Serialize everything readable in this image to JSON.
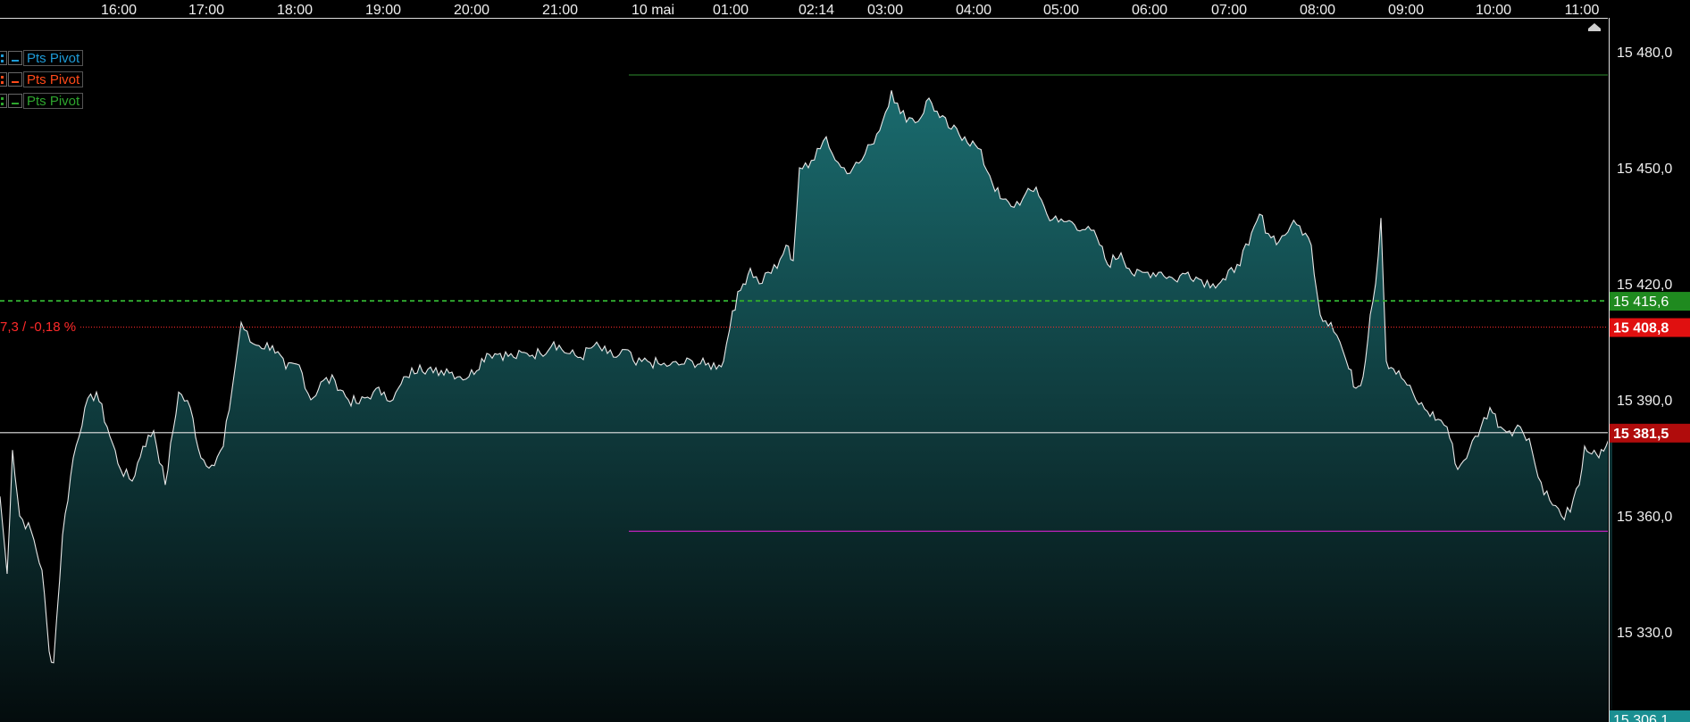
{
  "chart_data": {
    "type": "area",
    "time_labels": [
      "16:00",
      "17:00",
      "18:00",
      "19:00",
      "20:00",
      "21:00",
      "10 mai",
      "01:00",
      "02:14",
      "03:00",
      "04:00",
      "05:00",
      "06:00",
      "07:00",
      "08:00",
      "09:00",
      "10:00",
      "11:00"
    ],
    "y_ticks": [
      "15 480,0",
      "15 450,0",
      "15 420,0",
      "15 390,0",
      "15 360,0",
      "15 330,0"
    ],
    "y_tick_values": [
      15480,
      15450,
      15420,
      15390,
      15360,
      15330
    ],
    "ylim": [
      15296,
      15490
    ],
    "x_anchors": [
      {
        "t": 0,
        "v": 15365
      },
      {
        "t": 8,
        "v": 15345
      },
      {
        "t": 14,
        "v": 15377
      },
      {
        "t": 22,
        "v": 15360
      },
      {
        "t": 35,
        "v": 15356
      },
      {
        "t": 47,
        "v": 15346
      },
      {
        "t": 55,
        "v": 15325
      },
      {
        "t": 60,
        "v": 15322
      },
      {
        "t": 70,
        "v": 15355
      },
      {
        "t": 82,
        "v": 15375
      },
      {
        "t": 95,
        "v": 15388
      },
      {
        "t": 108,
        "v": 15392
      },
      {
        "t": 120,
        "v": 15383
      },
      {
        "t": 135,
        "v": 15372
      },
      {
        "t": 148,
        "v": 15369
      },
      {
        "t": 160,
        "v": 15378
      },
      {
        "t": 172,
        "v": 15382
      },
      {
        "t": 185,
        "v": 15368
      },
      {
        "t": 200,
        "v": 15392
      },
      {
        "t": 213,
        "v": 15388
      },
      {
        "t": 225,
        "v": 15375
      },
      {
        "t": 240,
        "v": 15373
      },
      {
        "t": 250,
        "v": 15378
      },
      {
        "t": 260,
        "v": 15393
      },
      {
        "t": 270,
        "v": 15410
      },
      {
        "t": 280,
        "v": 15405
      },
      {
        "t": 290,
        "v": 15404
      },
      {
        "t": 305,
        "v": 15404
      },
      {
        "t": 320,
        "v": 15398
      },
      {
        "t": 335,
        "v": 15399
      },
      {
        "t": 348,
        "v": 15390
      },
      {
        "t": 362,
        "v": 15395
      },
      {
        "t": 375,
        "v": 15395
      },
      {
        "t": 390,
        "v": 15390
      },
      {
        "t": 402,
        "v": 15389
      },
      {
        "t": 418,
        "v": 15392
      },
      {
        "t": 430,
        "v": 15392
      },
      {
        "t": 440,
        "v": 15390
      },
      {
        "t": 455,
        "v": 15396
      },
      {
        "t": 470,
        "v": 15399
      },
      {
        "t": 485,
        "v": 15397
      },
      {
        "t": 500,
        "v": 15398
      },
      {
        "t": 515,
        "v": 15396
      },
      {
        "t": 525,
        "v": 15396
      },
      {
        "t": 545,
        "v": 15402
      },
      {
        "t": 560,
        "v": 15402
      },
      {
        "t": 575,
        "v": 15401
      },
      {
        "t": 590,
        "v": 15402
      },
      {
        "t": 605,
        "v": 15402
      },
      {
        "t": 620,
        "v": 15405
      },
      {
        "t": 635,
        "v": 15402
      },
      {
        "t": 650,
        "v": 15401
      },
      {
        "t": 665,
        "v": 15404
      },
      {
        "t": 680,
        "v": 15402
      },
      {
        "t": 690,
        "v": 15401
      },
      {
        "t": 700,
        "v": 15403
      },
      {
        "t": 712,
        "v": 15399
      },
      {
        "t": 725,
        "v": 15400
      },
      {
        "t": 740,
        "v": 15399
      },
      {
        "t": 750,
        "v": 15399
      },
      {
        "t": 760,
        "v": 15399
      },
      {
        "t": 775,
        "v": 15400
      },
      {
        "t": 790,
        "v": 15399
      },
      {
        "t": 805,
        "v": 15399
      },
      {
        "t": 810,
        "v": 15400
      },
      {
        "t": 820,
        "v": 15413
      },
      {
        "t": 832,
        "v": 15420
      },
      {
        "t": 840,
        "v": 15424
      },
      {
        "t": 850,
        "v": 15420
      },
      {
        "t": 860,
        "v": 15423
      },
      {
        "t": 870,
        "v": 15424
      },
      {
        "t": 880,
        "v": 15430
      },
      {
        "t": 888,
        "v": 15426
      },
      {
        "t": 895,
        "v": 15450
      },
      {
        "t": 905,
        "v": 15450
      },
      {
        "t": 915,
        "v": 15455
      },
      {
        "t": 925,
        "v": 15458
      },
      {
        "t": 935,
        "v": 15452
      },
      {
        "t": 945,
        "v": 15450
      },
      {
        "t": 955,
        "v": 15450
      },
      {
        "t": 965,
        "v": 15452
      },
      {
        "t": 975,
        "v": 15456
      },
      {
        "t": 988,
        "v": 15462
      },
      {
        "t": 998,
        "v": 15470
      },
      {
        "t": 1008,
        "v": 15464
      },
      {
        "t": 1018,
        "v": 15463
      },
      {
        "t": 1028,
        "v": 15462
      },
      {
        "t": 1040,
        "v": 15468
      },
      {
        "t": 1052,
        "v": 15463
      },
      {
        "t": 1065,
        "v": 15460
      },
      {
        "t": 1080,
        "v": 15458
      },
      {
        "t": 1095,
        "v": 15455
      },
      {
        "t": 1108,
        "v": 15448
      },
      {
        "t": 1120,
        "v": 15442
      },
      {
        "t": 1132,
        "v": 15440
      },
      {
        "t": 1145,
        "v": 15442
      },
      {
        "t": 1160,
        "v": 15445
      },
      {
        "t": 1172,
        "v": 15438
      },
      {
        "t": 1185,
        "v": 15436
      },
      {
        "t": 1200,
        "v": 15436
      },
      {
        "t": 1215,
        "v": 15434
      },
      {
        "t": 1228,
        "v": 15432
      },
      {
        "t": 1240,
        "v": 15425
      },
      {
        "t": 1255,
        "v": 15428
      },
      {
        "t": 1270,
        "v": 15422
      },
      {
        "t": 1285,
        "v": 15423
      },
      {
        "t": 1300,
        "v": 15423
      },
      {
        "t": 1315,
        "v": 15421
      },
      {
        "t": 1330,
        "v": 15423
      },
      {
        "t": 1345,
        "v": 15421
      },
      {
        "t": 1358,
        "v": 15420
      },
      {
        "t": 1372,
        "v": 15421
      },
      {
        "t": 1385,
        "v": 15425
      },
      {
        "t": 1398,
        "v": 15430
      },
      {
        "t": 1410,
        "v": 15438
      },
      {
        "t": 1420,
        "v": 15433
      },
      {
        "t": 1432,
        "v": 15431
      },
      {
        "t": 1445,
        "v": 15435
      },
      {
        "t": 1455,
        "v": 15435
      },
      {
        "t": 1468,
        "v": 15430
      },
      {
        "t": 1478,
        "v": 15412
      },
      {
        "t": 1490,
        "v": 15410
      },
      {
        "t": 1500,
        "v": 15405
      },
      {
        "t": 1510,
        "v": 15398
      },
      {
        "t": 1518,
        "v": 15393
      },
      {
        "t": 1526,
        "v": 15396
      },
      {
        "t": 1534,
        "v": 15412
      },
      {
        "t": 1540,
        "v": 15420
      },
      {
        "t": 1546,
        "v": 15437
      },
      {
        "t": 1552,
        "v": 15400
      },
      {
        "t": 1560,
        "v": 15398
      },
      {
        "t": 1572,
        "v": 15395
      },
      {
        "t": 1585,
        "v": 15390
      },
      {
        "t": 1598,
        "v": 15387
      },
      {
        "t": 1610,
        "v": 15385
      },
      {
        "t": 1620,
        "v": 15383
      },
      {
        "t": 1632,
        "v": 15372
      },
      {
        "t": 1645,
        "v": 15377
      },
      {
        "t": 1658,
        "v": 15383
      },
      {
        "t": 1668,
        "v": 15388
      },
      {
        "t": 1680,
        "v": 15383
      },
      {
        "t": 1690,
        "v": 15382
      },
      {
        "t": 1702,
        "v": 15383
      },
      {
        "t": 1712,
        "v": 15380
      },
      {
        "t": 1722,
        "v": 15370
      },
      {
        "t": 1735,
        "v": 15364
      },
      {
        "t": 1748,
        "v": 15360
      },
      {
        "t": 1758,
        "v": 15361
      },
      {
        "t": 1768,
        "v": 15368
      },
      {
        "t": 1774,
        "v": 15378
      },
      {
        "t": 1782,
        "v": 15376
      },
      {
        "t": 1790,
        "v": 15375
      },
      {
        "t": 1798,
        "v": 15378
      },
      {
        "t": 1805,
        "v": 15383
      }
    ],
    "pivot_high": 15474,
    "pivot_low": 15356,
    "previous_close": 15408.8,
    "current_price": 15381.5,
    "green_level": 15415.6,
    "low_marker": 15306.1,
    "grid": false,
    "colors": {
      "line": "#e8e8e8",
      "fill_top": "#1a6b6e",
      "fill_bottom": "#040c0d",
      "pivot_high": "#1f5f1f",
      "pivot_low": "#b022b0",
      "prev_close": "#ff2a2a",
      "green_level": "#2fa52f",
      "current": "#e5e5e5",
      "blue": "#1e9bd7",
      "orange": "#ff4a1a",
      "green": "#2ea62e"
    }
  },
  "legend": [
    {
      "name": "Pts Pivot",
      "color": "#1e9bd7"
    },
    {
      "name": "Pts Pivot",
      "color": "#ff4a1a"
    },
    {
      "name": "Pts Pivot",
      "color": "#2ea62e"
    }
  ],
  "change_label": "7,3 / -0,18 %",
  "price_badges": {
    "green": "15 415,6",
    "prev_close": "15 408,8",
    "current": "15 381,5",
    "low": "15 306,1"
  }
}
